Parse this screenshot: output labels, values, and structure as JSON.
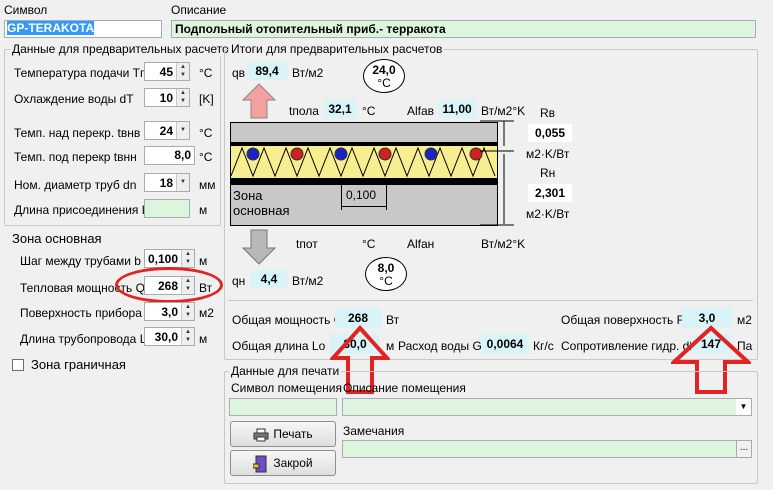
{
  "header": {
    "symbol_label": "Символ",
    "symbol_value": "GP-TERAKOTA",
    "description_label": "Описание",
    "description_value": "Подпольный отопительный приб.- терракота"
  },
  "prelim": {
    "title": "Данные для предварительных расчетов",
    "supply_temp": {
      "label": "Температура подачи  Tп",
      "value": "45",
      "unit": "°C"
    },
    "cooling": {
      "label": "Охлаждение воды dT",
      "value": "10",
      "unit": "[K]"
    },
    "temp_above": {
      "label": "Темп. над перекр. tвнв",
      "value": "24",
      "unit": "°C"
    },
    "temp_below": {
      "label": "Темп. под перекр tвнн",
      "value": "8,0",
      "unit": "°C"
    },
    "pipe_dia": {
      "label": "Ном. диаметр труб dn",
      "value": "18",
      "unit": "мм"
    },
    "conn_len": {
      "label": "Длина присоединения Lr",
      "value": "",
      "unit": "м"
    }
  },
  "zone": {
    "title": "Зона основная",
    "pitch": {
      "label": "Шаг между трубами b",
      "value": "0,100",
      "unit": "м"
    },
    "power": {
      "label": "Тепловая мощность Qo",
      "value": "268",
      "unit": "Вт"
    },
    "area": {
      "label": "Поверхность прибора F",
      "value": "3,0",
      "unit": "м2"
    },
    "pipe_len": {
      "label": "Длина трубопровода L",
      "value": "30,0",
      "unit": "м"
    }
  },
  "boundary": {
    "label": "Зона граничная",
    "checked": false
  },
  "results": {
    "title": "Итоги для предварительных расчетов",
    "qv_label": "qв",
    "qv_value": "89,4",
    "qv_unit": "Вт/м2",
    "t_top": "24,0",
    "t_top_unit": "°C",
    "tfloor_label": "tпола",
    "tfloor_value": "32,1",
    "tfloor_unit": "°C",
    "alfav_label": "Alfав",
    "alfav_value": "11,00",
    "alfav_unit": "Вт/м2°K",
    "rv_label": "Rв",
    "rv_value": "0,055",
    "rv_unit": "м2·K/Вт",
    "rn_label": "Rн",
    "rn_value": "2,301",
    "rn_unit": "м2·K/Вт",
    "zone_text1": "Зона",
    "zone_text2": "основная",
    "pitch_value": "0,100",
    "tpot_label": "tпот",
    "tpot_value": "",
    "tpot_unit": "°C",
    "alfan_label": "Alfaн",
    "alfan_value": "",
    "alfan_unit": "Вт/м2°K",
    "qn_label": "qн",
    "qn_value": "4,4",
    "qn_unit": "Вт/м2",
    "t_bottom": "8,0",
    "t_bottom_unit": "°C",
    "total_power_label": "Общая мощность Q",
    "total_power_value": "268",
    "total_power_unit": "Вт",
    "total_area_label": "Общая поверхность Fo",
    "total_area_value": "3,0",
    "total_area_unit": "м2",
    "total_len_label": "Общая длина Lo",
    "total_len_value": "30,0",
    "total_len_unit": "м",
    "flow_label": "Расход воды G",
    "flow_value": "0,0064",
    "flow_unit": "Кг/с",
    "resist_label": "Сопротивление гидр. dP",
    "resist_value": "147",
    "resist_unit": "Па"
  },
  "print": {
    "title": "Данные для печати",
    "room_symbol_label": "Символ помещения",
    "room_desc_label": "Описание помещения",
    "notes_label": "Замечания",
    "print_button": "Печать",
    "close_button": "Закрой",
    "dots": "..."
  }
}
